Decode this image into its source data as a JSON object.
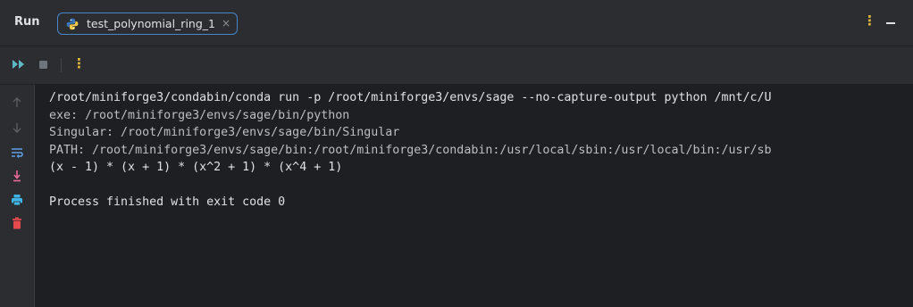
{
  "header": {
    "run_label": "Run",
    "tab_label": "test_polynomial_ring_1",
    "tab_close": "×",
    "more_label": "⋮"
  },
  "toolbar": {
    "rerun_icon": "rerun-icon",
    "stop_icon": "stop-icon",
    "more_label": "⋮"
  },
  "gutter": {
    "icons": [
      "up-arrow-icon",
      "down-arrow-icon",
      "soft-wrap-icon",
      "scroll-to-end-icon",
      "print-icon",
      "trash-icon"
    ]
  },
  "console": {
    "lines": [
      "/root/miniforge3/condabin/conda run -p /root/miniforge3/envs/sage --no-capture-output python /mnt/c/U",
      "exe: /root/miniforge3/envs/sage/bin/python",
      "Singular: /root/miniforge3/envs/sage/bin/Singular",
      "PATH: /root/miniforge3/envs/sage/bin:/root/miniforge3/condabin:/usr/local/sbin:/usr/local/bin:/usr/sb",
      "(x - 1) * (x + 1) * (x^2 + 1) * (x^4 + 1)",
      "",
      "Process finished with exit code 0"
    ]
  },
  "colors": {
    "background": "#1e1f22",
    "panel": "#2b2d30",
    "tab_border": "#4a86c7",
    "accent_more": "#e2b93b",
    "print_icon": "#3fb5e5",
    "trash_icon": "#e5484d",
    "scroll_end_icon": "#e86a9a"
  }
}
